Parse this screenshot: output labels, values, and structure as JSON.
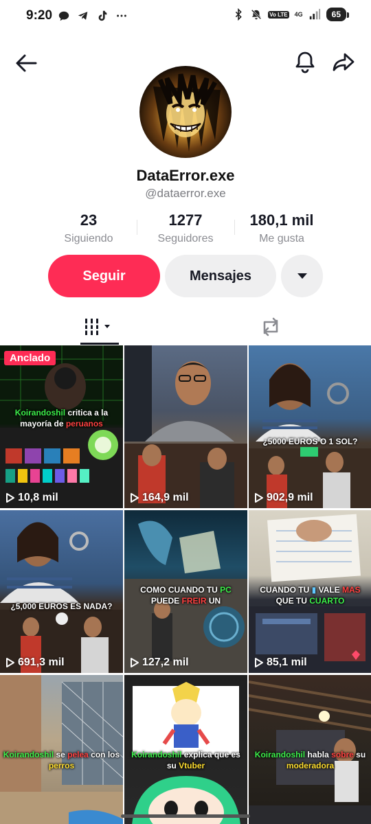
{
  "status_bar": {
    "time": "9:20",
    "battery": "65",
    "network": "4G",
    "volte": "Vo LTE"
  },
  "profile": {
    "display_name": "DataError.exe",
    "username": "@dataerror.exe",
    "avatar_icon": "avatar-image"
  },
  "stats": [
    {
      "value": "23",
      "label": "Siguiendo"
    },
    {
      "value": "1277",
      "label": "Seguidores"
    },
    {
      "value": "180,1 mil",
      "label": "Me gusta"
    }
  ],
  "actions": {
    "follow_label": "Seguir",
    "message_label": "Mensajes"
  },
  "videos": [
    {
      "views": "10,8 mil",
      "pinned_label": "Anclado",
      "caption_a": "Koirandoshil",
      "caption_b": " critica a la mayoría de ",
      "caption_c": "peruanos"
    },
    {
      "views": "164,9 mil"
    },
    {
      "views": "902,9 mil",
      "caption_a": "¿5000 EUROS O 1 SOL?"
    },
    {
      "views": "691,3 mil",
      "caption_a": "¿5,000 EUROS ES NADA?"
    },
    {
      "views": "127,2 mil",
      "caption_a": "COMO CUANDO TU ",
      "caption_b": "PC",
      "caption_c": " PUEDE ",
      "caption_d": "FREIR",
      "caption_e": " UN "
    },
    {
      "views": "85,1 mil",
      "caption_a": "CUANDO TU ",
      "caption_b": " VALE ",
      "caption_c": "MAS",
      "caption_d": " QUE TU ",
      "caption_e": "CUARTO"
    },
    {
      "caption_a": "Koirandoshil",
      "caption_b": " se ",
      "caption_c": "pelea",
      "caption_d": " con los ",
      "caption_e": "perros"
    },
    {
      "caption_a": "Koirandoshil",
      "caption_b": " explica que es su ",
      "caption_c": "Vtuber"
    },
    {
      "caption_a": "Koirandoshil",
      "caption_b": " habla ",
      "caption_c": "sobre",
      "caption_d": " su ",
      "caption_e": "moderadora"
    }
  ]
}
